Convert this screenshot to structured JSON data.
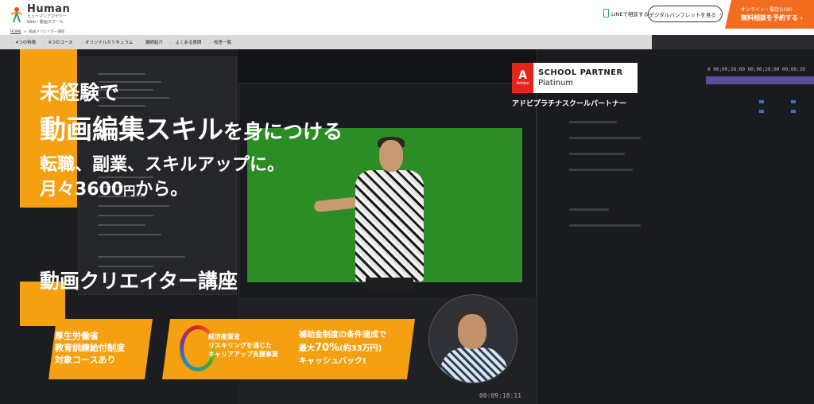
{
  "header": {
    "logo_main": "Human",
    "logo_sub": "ヒューマンアカデミー",
    "logo_sub2": "Web・動画スクール",
    "line_label": "LINEで相談する",
    "pamphlet_label": "デジタルパンフレットを見る",
    "pamphlet_arrow": "›",
    "cta_small": "オンライン・電話もOK!",
    "cta_big": "無料相談を予約する",
    "cta_arrow": "›"
  },
  "breadcrumb": {
    "home": "HOME",
    "sep": ">",
    "current": "動画クリエイター講座"
  },
  "nav": {
    "items": [
      "4つの特徴",
      "4つのコース",
      "オリジナルカリキュラム",
      "講師紹介",
      "よくある質問",
      "校舎一覧"
    ]
  },
  "hero": {
    "line1": "未経験で",
    "line2_main": "動画編集スキル",
    "line2_tail": "を身につける",
    "line3": "転職、副業、スキルアップに。",
    "line4_main": "月々3600",
    "line4_unit": "円",
    "line4_tail": "から。",
    "course_title": "動画クリエイター講座"
  },
  "adobe": {
    "logo_letter": "A",
    "logo_word": "Adobe",
    "title": "SCHOOL PARTNER",
    "tier": "Platinum",
    "caption": "アドビプラチナスクールパートナー"
  },
  "cards": {
    "card1_l1": "厚生労働省",
    "card1_l2": "教育訓練給付制度",
    "card1_l3": "対象コースあり",
    "card2_l1": "経済産業省",
    "card2_l2": "リスキリングを通じた",
    "card2_l3": "キャリアアップ支援事業",
    "card2_r1": "補助金制度の条件達成で",
    "card2_r2_a": "最大",
    "card2_r2_pct": "70%",
    "card2_r2_b": "(約33万円)",
    "card2_r3": "キャッシュバック!"
  },
  "editor": {
    "timecode": "00:09:18:11",
    "ruler": "0 00;00;28;00  00;00;28;00  00;00;30"
  },
  "colors": {
    "accent_orange": "#f5a010",
    "cta_orange": "#f36d21",
    "adobe_red": "#e1251b",
    "line_green": "#2bb24c"
  }
}
